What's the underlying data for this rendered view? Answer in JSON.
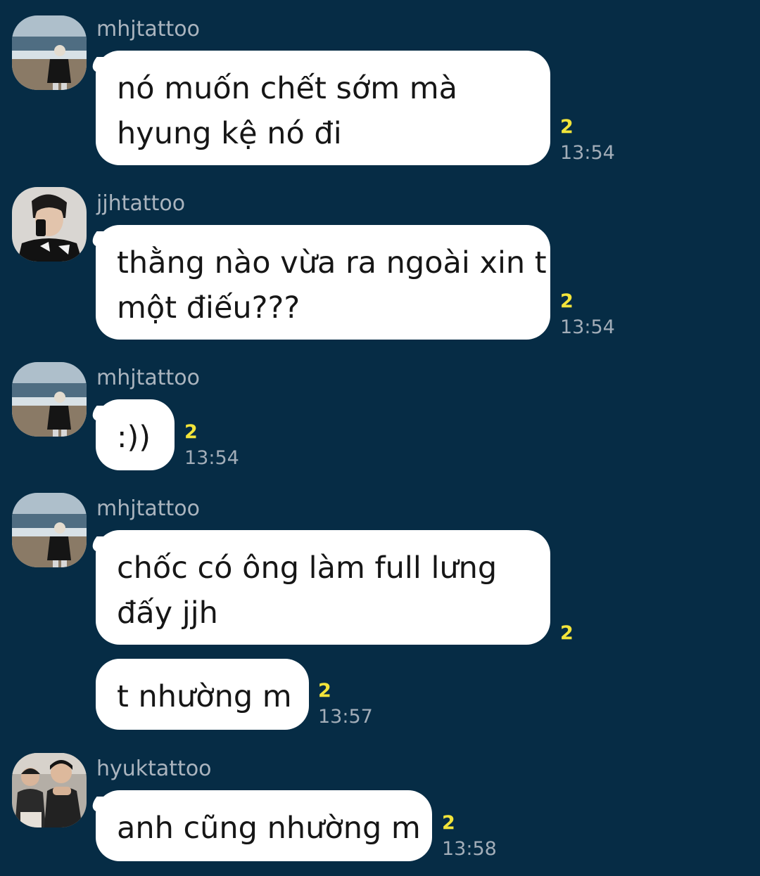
{
  "messages": [
    {
      "sender": "mhjtattoo",
      "lines": [
        "nó muốn chết sớm mà",
        "hyung kệ nó đi"
      ],
      "unread": "2",
      "time": "13:54"
    },
    {
      "sender": "jjhtattoo",
      "lines": [
        "thằng nào vừa ra ngoài xin t",
        "một điếu???"
      ],
      "unread": "2",
      "time": "13:54"
    },
    {
      "sender": "mhjtattoo",
      "lines": [
        ":))"
      ],
      "unread": "2",
      "time": "13:54"
    },
    {
      "sender": "mhjtattoo",
      "lines": [
        "chốc có ông làm full lưng",
        "đấy jjh"
      ],
      "unread": "2",
      "time": ""
    },
    {
      "sender": "",
      "lines": [
        "t nhường m"
      ],
      "unread": "2",
      "time": "13:57"
    },
    {
      "sender": "hyuktattoo",
      "lines": [
        "anh cũng nhường m"
      ],
      "unread": "2",
      "time": "13:58"
    }
  ],
  "icons": {
    "avatar_mhj": "avatar-beach-photo",
    "avatar_jjh": "avatar-phone-photo",
    "avatar_hyuk": "avatar-group-photo"
  },
  "colors": {
    "background": "#062c45",
    "bubble": "#ffffff",
    "unread": "#f2e43a",
    "sender_name": "#aab4be",
    "timestamp": "#a2adb8"
  }
}
